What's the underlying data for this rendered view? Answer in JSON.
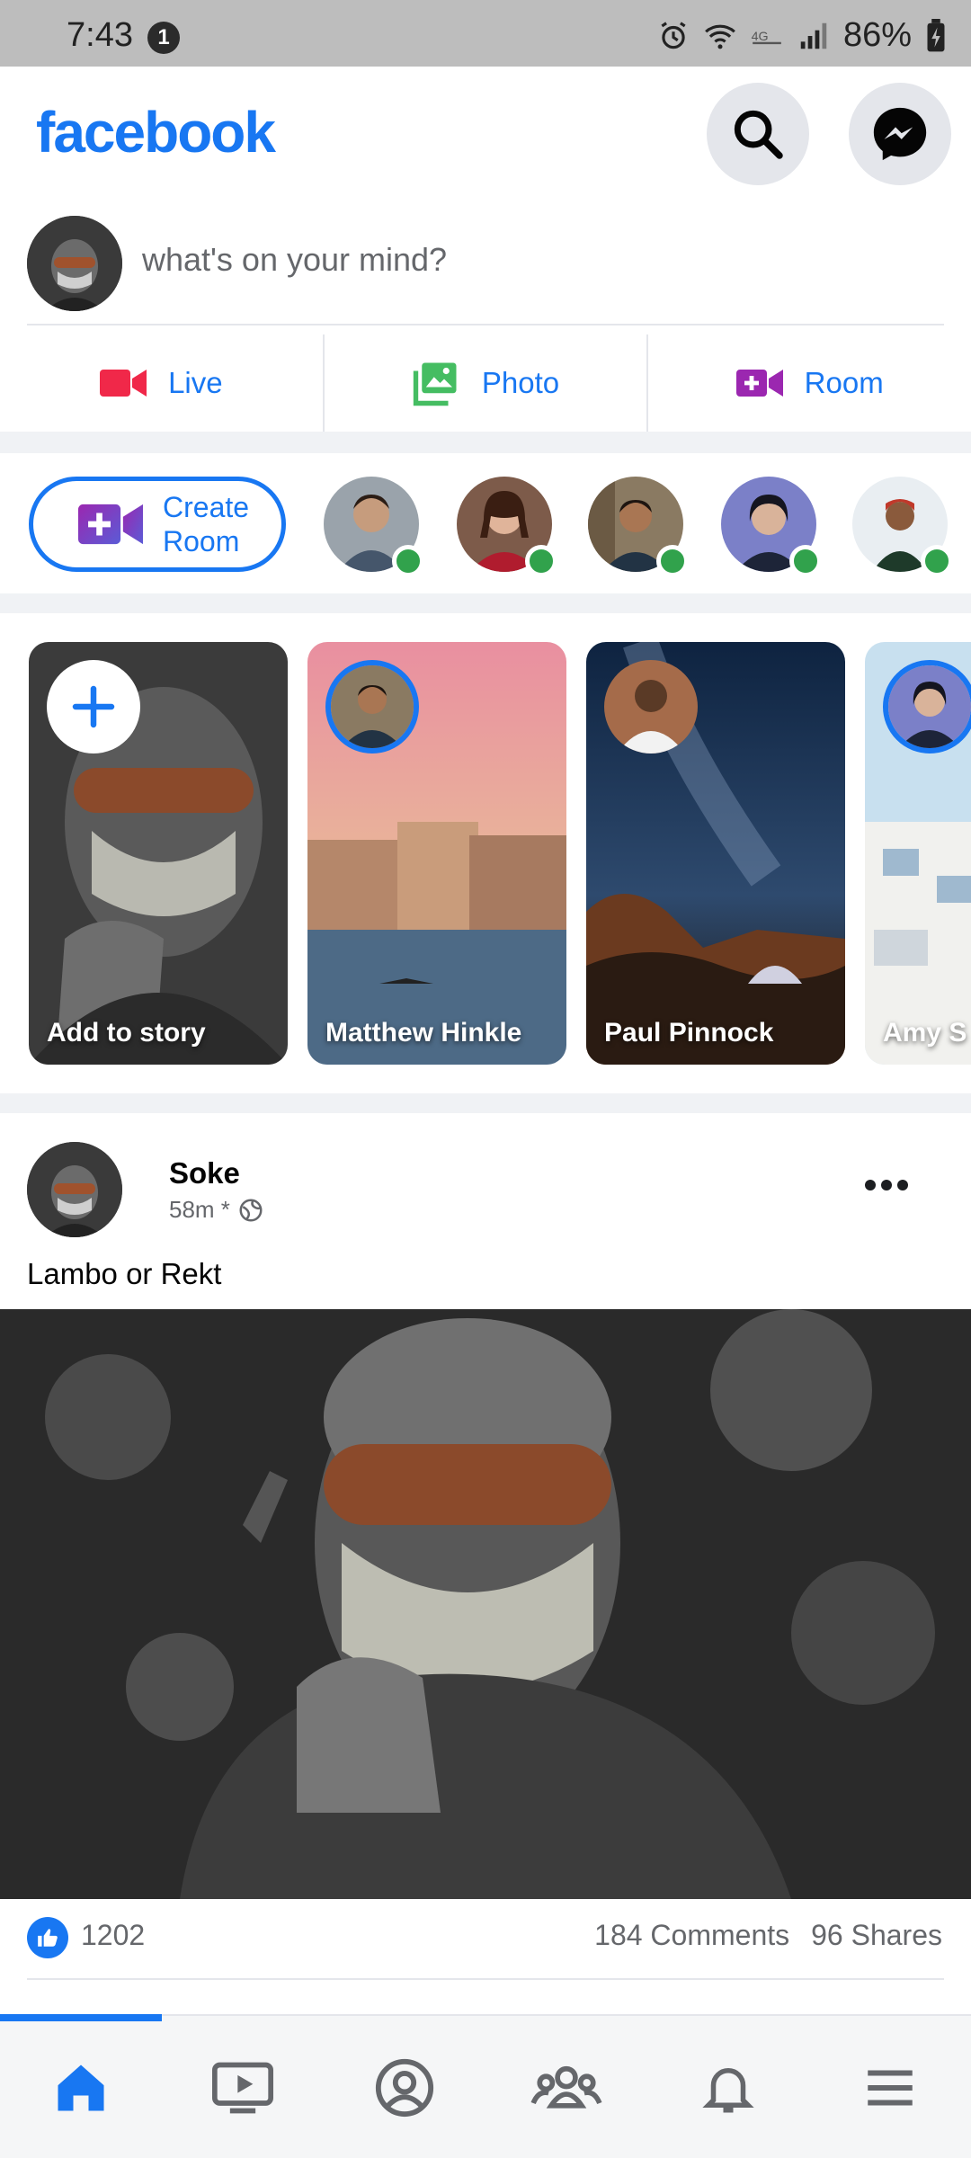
{
  "status_bar": {
    "time": "7:43",
    "notification_count": "1",
    "battery": "86%"
  },
  "header": {
    "logo": "facebook",
    "brand_color": "#1877f2"
  },
  "composer": {
    "placeholder": "what's on your mind?",
    "actions": [
      {
        "label": "Live",
        "icon": "video-camera-icon",
        "color": "#f02849"
      },
      {
        "label": "Photo",
        "icon": "photo-icon",
        "color": "#45bd62"
      },
      {
        "label": "Room",
        "icon": "room-video-icon",
        "color": "#9b27b0"
      }
    ]
  },
  "rooms": {
    "create_label": "Create Room",
    "online_color": "#31a24c",
    "people_count_visible": 5
  },
  "stories": [
    {
      "name": "Add to story",
      "type": "add"
    },
    {
      "name": "Matthew Hinkle",
      "type": "story"
    },
    {
      "name": "Paul Pinnock",
      "type": "story"
    },
    {
      "name": "Amy S",
      "type": "story"
    }
  ],
  "post": {
    "author": "Soke",
    "time": "58m *",
    "privacy_icon": "globe-icon",
    "text": "Lambo or Rekt",
    "likes": "1202",
    "comments": "184 Comments",
    "shares": "96 Shares"
  },
  "bottom_nav": {
    "items": [
      {
        "name": "home-icon",
        "active": true
      },
      {
        "name": "watch-icon",
        "active": false
      },
      {
        "name": "profile-icon",
        "active": false
      },
      {
        "name": "groups-icon",
        "active": false
      },
      {
        "name": "notifications-icon",
        "active": false
      },
      {
        "name": "menu-icon",
        "active": false
      }
    ]
  }
}
